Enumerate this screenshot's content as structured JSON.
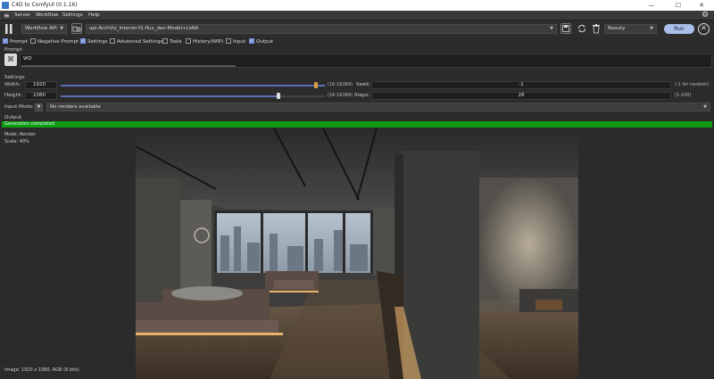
{
  "window": {
    "title": "C4D to ComfyUI  (0.1.16)",
    "minimize": "—",
    "maximize": "☐",
    "close": "✕"
  },
  "menu": {
    "items": [
      "Server",
      "Workflow",
      "Settings",
      "Help"
    ]
  },
  "toolbar": {
    "workflow_select": "Workflow API",
    "workflow_file": "api-ArchViz_Interior-f1-flux_dev-Model+LoRA",
    "pass_select": "Beauty",
    "run_label": "Run"
  },
  "checks": [
    {
      "label": "Prompt",
      "checked": true
    },
    {
      "label": "Negative Prompt",
      "checked": false
    },
    {
      "label": "Settings",
      "checked": true
    },
    {
      "label": "Advanced Settings",
      "checked": false
    },
    {
      "label": "Tools",
      "checked": false
    },
    {
      "label": "History(WIP)",
      "checked": false
    },
    {
      "label": "Input",
      "checked": false
    },
    {
      "label": "Output",
      "checked": true
    }
  ],
  "prompt": {
    "section": "Prompt",
    "text": "WD"
  },
  "settings": {
    "section": "Settings",
    "width": {
      "label": "Width:",
      "value": "1920",
      "range": "(16-16384)",
      "fill": 0.117
    },
    "height": {
      "label": "Height:",
      "value": "1080",
      "range": "(16-16384)",
      "fill": 0.066
    },
    "seed": {
      "label": "Seed:",
      "value": "-1",
      "hint": "(-1 for random)"
    },
    "steps": {
      "label": "Steps:",
      "value": "28",
      "hint": "(1-100)"
    }
  },
  "input_mode": {
    "label": "Input Mode:",
    "value": "No renders available"
  },
  "output": {
    "section": "Output",
    "status": "Generation completed",
    "mode": "Mode: Render",
    "scale": "Scale: 49%",
    "image_info": "Image: 1920 x 1080, RGB (8 bits)"
  }
}
